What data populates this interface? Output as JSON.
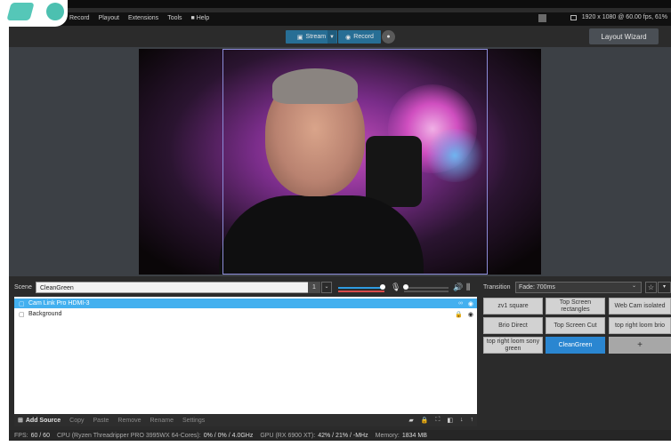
{
  "menu": {
    "items": [
      "Record",
      "Playout",
      "Extensions",
      "Tools",
      "Help"
    ]
  },
  "header": {
    "resolution": "1920 x 1080 @ 60.00 fps, 61%"
  },
  "toolbar": {
    "stream_label": "Stream",
    "record_label": "Record",
    "layout_wizard_label": "Layout Wizard"
  },
  "scene": {
    "label": "Scene",
    "name": "CleanGreen",
    "number": "1"
  },
  "audio": {
    "desktop_level": 0.85,
    "mic_level": 0.08
  },
  "sources": {
    "items": [
      {
        "name": "Cam Link Pro HDMI-3",
        "selected": true
      },
      {
        "name": "Background",
        "selected": false
      }
    ],
    "add_label": "Add Source",
    "actions": [
      "Copy",
      "Paste",
      "Remove",
      "Rename",
      "Settings"
    ]
  },
  "transition": {
    "label": "Transition",
    "value": "Fade: 700ms"
  },
  "scenes": {
    "buttons": [
      "zv1 square",
      "Top Screen rectangles",
      "Web Cam isolated",
      "Brio Direct",
      "Top Screen Cut",
      "top right loom brio",
      "top right loom sony green",
      "CleanGreen",
      "+"
    ],
    "active": "CleanGreen"
  },
  "status": {
    "fps_label": "FPS:",
    "fps_value": "60 / 60",
    "cpu_label": "CPU (Ryzen Threadripper PRO 3995WX 64-Cores):",
    "cpu_value": "0% / 0% / 4.0GHz",
    "gpu_label": "GPU (RX 6900 XT):",
    "gpu_value": "42% / 21% / -MHz",
    "memory_label": "Memory:",
    "memory_value": "1834 MB"
  },
  "colors": {
    "accent": "#276e95",
    "selection": "#43b0ef",
    "active_scene": "#2a86d1"
  }
}
